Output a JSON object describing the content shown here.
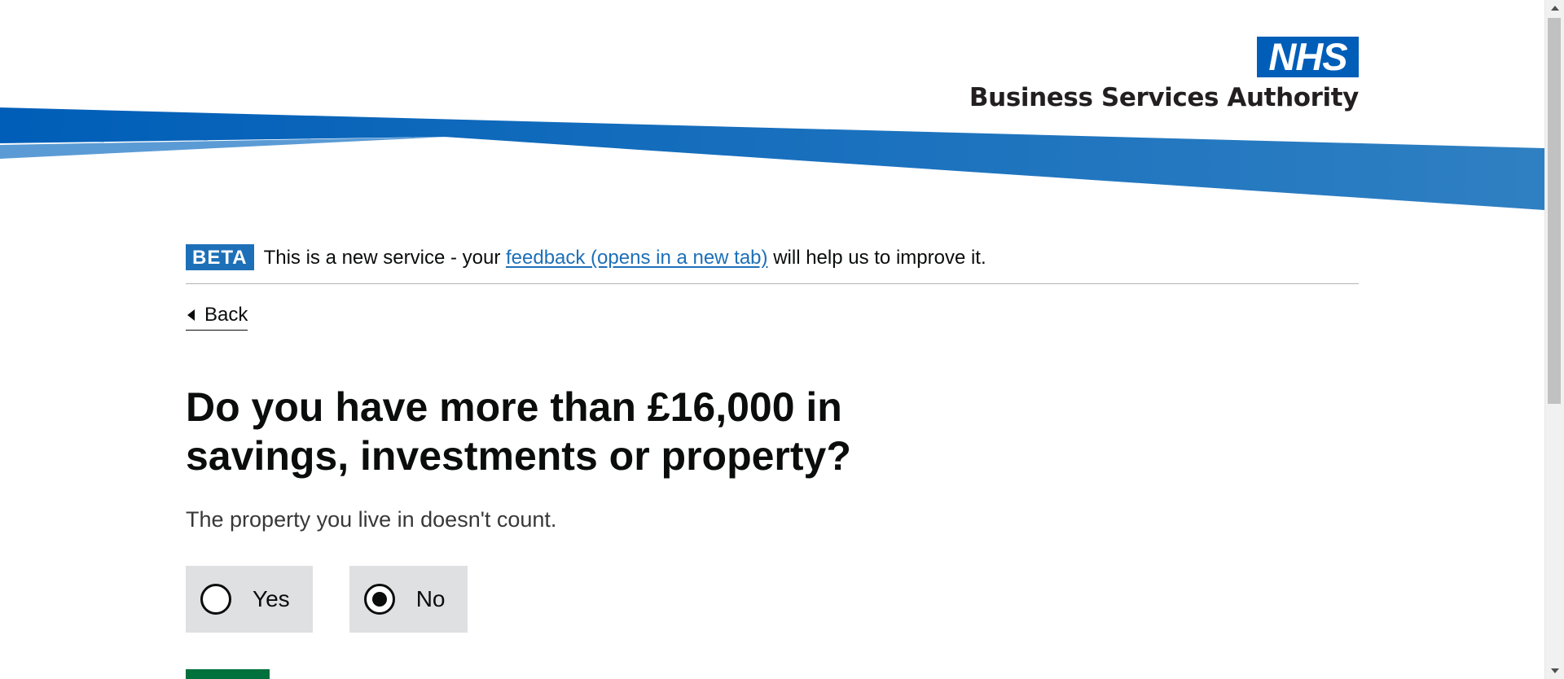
{
  "header": {
    "logo_mark": "NHS",
    "org_name": "Business Services Authority",
    "colors": {
      "swoosh_dark": "#005eb8",
      "swoosh_mid": "#1d70b8",
      "swoosh_light": "#41b6e6",
      "nhs_blue": "#005eb8"
    }
  },
  "phase_banner": {
    "tag": "BETA",
    "text_before": "This is a new service - your ",
    "link_text": "feedback (opens in a new tab)",
    "text_after": " will help us to improve it."
  },
  "back_link": {
    "label": "Back"
  },
  "question": {
    "heading": "Do you have more than £16,000 in savings, investments or property?",
    "hint": "The property you live in doesn't count."
  },
  "radios": {
    "options": [
      {
        "label": "Yes",
        "checked": false
      },
      {
        "label": "No",
        "checked": true
      }
    ]
  },
  "actions": {
    "continue_color": "#00703c"
  }
}
